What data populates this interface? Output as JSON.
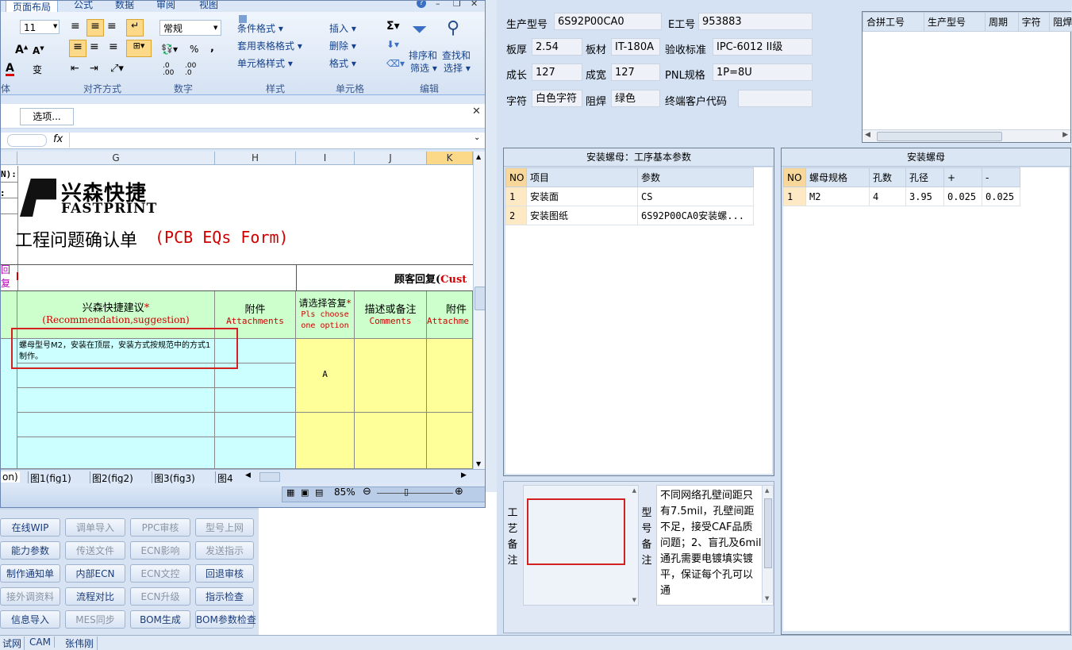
{
  "right_form": {
    "model_label": "生产型号",
    "model_value": "6S92P00CA0",
    "eno_label": "E工号",
    "eno_value": "953883",
    "thickness_label": "板厚",
    "thickness_value": "2.54",
    "material_label": "板材",
    "material_value": "IT-180A",
    "standard_label": "验收标准",
    "standard_value": "IPC-6012 II级",
    "length_label": "成长",
    "length_value": "127",
    "width_label": "成宽",
    "width_value": "127",
    "pnl_label": "PNL规格",
    "pnl_value": "1P=8U",
    "legend_label": "字符",
    "legend_value": "白色字符",
    "mask_label": "阻焊",
    "mask_value": "绿色",
    "customer_label": "终端客户代码",
    "customer_value": ""
  },
  "merge_table": {
    "headers": [
      "合拼工号",
      "生产型号",
      "周期",
      "字符",
      "阻焊"
    ]
  },
  "process_panel": {
    "title": "安装螺母：工序基本参数",
    "headers": [
      "NO",
      "项目",
      "参数"
    ],
    "rows": [
      [
        "1",
        "安装面",
        "CS"
      ],
      [
        "2",
        "安装图纸",
        "6S92P00CA0安装螺..."
      ]
    ]
  },
  "nut_panel": {
    "title": "安装螺母",
    "headers": [
      "NO",
      "螺母规格",
      "孔数",
      "孔径",
      "+",
      "-"
    ],
    "rows": [
      [
        "1",
        "M2",
        "4",
        "3.95",
        "0.025",
        "0.025"
      ]
    ]
  },
  "notes": {
    "process_label": "工艺备注",
    "model_label": "型号备注",
    "model_text": "不同网络孔壁间距只有7.5mil，孔壁间距不足，接受CAF品质问题；2、盲孔及6mil通孔需要电镀填实镀平，保证每个孔可以通"
  },
  "excel": {
    "tabs": [
      "页面布局",
      "公式",
      "数据",
      "审阅",
      "视图"
    ],
    "font_size": "11",
    "number_format": "常规",
    "ribbon": {
      "cond_format": "条件格式 ▾",
      "table_format": "套用表格格式 ▾",
      "cell_style": "单元格样式 ▾",
      "insert": "插入 ▾",
      "delete": "删除 ▾",
      "format": "格式 ▾",
      "sort_filter_1": "排序和",
      "sort_filter_2": "筛选 ▾",
      "find_select_1": "查找和",
      "find_select_2": "选择 ▾"
    },
    "groups": {
      "font": "体",
      "align": "对齐方式",
      "number": "数字",
      "styles": "样式",
      "cells": "单元格",
      "editing": "编辑"
    },
    "options_button": "选项...",
    "fx": "fx",
    "columns": [
      "G",
      "H",
      "I",
      "J",
      "K"
    ],
    "row_frag_1": "N):",
    "row_frag_2": ":",
    "logo_cn": "兴森快捷",
    "logo_en": "FASTPRINT",
    "form_title_cn": "工程问题确认单",
    "form_title_en": "(PCB EQs Form)",
    "fragment_left": "回复",
    "customer_reply": "顾客回复(",
    "customer_reply_red": "Cust",
    "rec_cn": "兴森快捷建议",
    "rec_en": "(Recommendation,suggestion)",
    "attach_cn": "附件",
    "attach_en": "Attachments",
    "choose_cn": "请选择答复",
    "choose_en1": "Pls choose",
    "choose_en2": "one option",
    "desc_cn": "描述或备注",
    "desc_en": "Comments",
    "attach2_cn": "附件",
    "attach2_en": "Attachme",
    "recommendation_text": "螺母型号M2，安装在顶层，安装方式按规范中的方式1制作。",
    "answer": "A",
    "sheet_tabs": [
      "on)",
      "图1(fig1)",
      "图2(fig2)",
      "图3(fig3)",
      "图4"
    ],
    "zoom": "85%"
  },
  "buttons": [
    [
      "在线WIP",
      "调单导入",
      "PPC审核",
      "型号上网"
    ],
    [
      "能力参数",
      "传送文件",
      "ECN影响",
      "发送指示"
    ],
    [
      "制作通知单",
      "内部ECN",
      "ECN文控",
      "回退审核"
    ],
    [
      "接外调资料",
      "流程对比",
      "ECN升级",
      "指示检查"
    ],
    [
      "信息导入",
      "MES同步",
      "BOM生成",
      "BOM参数检查"
    ]
  ],
  "taskbar": [
    "试网",
    "CAM",
    "张伟刚"
  ],
  "colors": {
    "red_box": "#d32020",
    "cyan_cell": "#ccffff",
    "green_header": "#ccffcc",
    "yellow_cell": "#ffff99"
  }
}
